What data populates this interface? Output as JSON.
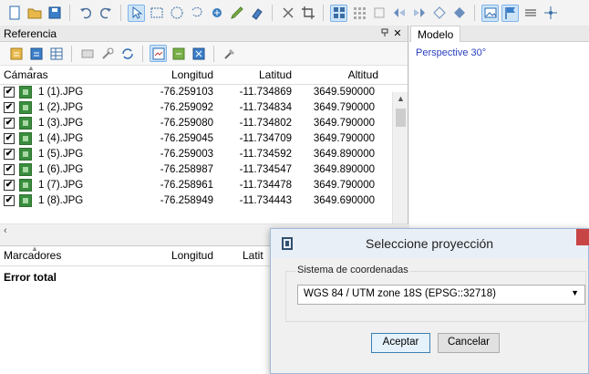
{
  "toolbar": {
    "icons": [
      "new-icon",
      "open-icon",
      "save-icon",
      "undo-icon",
      "redo-icon",
      "select-icon",
      "rect-select-icon",
      "circle-select-icon",
      "lasso-icon",
      "add-marker-icon",
      "draw-icon",
      "paint-icon",
      "delete-selection-icon",
      "crop-icon",
      "grid-icon",
      "dense-grid-icon",
      "transform-icon",
      "rotate-left-icon",
      "rotate-right-icon",
      "nav-icon",
      "rotate-icon",
      "image-icon",
      "flag-icon",
      "layers-icon",
      "move-icon"
    ]
  },
  "reference_pane": {
    "title": "Referencia",
    "pin": "ꝏ",
    "close": "✕",
    "columns": {
      "name": "Cámaras",
      "lon": "Longitud",
      "lat": "Latitud",
      "alt": "Altitud"
    },
    "cameras": [
      {
        "checked": true,
        "name": "1 (1).JPG",
        "lon": "-76.259103",
        "lat": "-11.734869",
        "alt": "3649.590000"
      },
      {
        "checked": true,
        "name": "1 (2).JPG",
        "lon": "-76.259092",
        "lat": "-11.734834",
        "alt": "3649.790000"
      },
      {
        "checked": true,
        "name": "1 (3).JPG",
        "lon": "-76.259080",
        "lat": "-11.734802",
        "alt": "3649.790000"
      },
      {
        "checked": true,
        "name": "1 (4).JPG",
        "lon": "-76.259045",
        "lat": "-11.734709",
        "alt": "3649.790000"
      },
      {
        "checked": true,
        "name": "1 (5).JPG",
        "lon": "-76.259003",
        "lat": "-11.734592",
        "alt": "3649.890000"
      },
      {
        "checked": true,
        "name": "1 (6).JPG",
        "lon": "-76.258987",
        "lat": "-11.734547",
        "alt": "3649.890000"
      },
      {
        "checked": true,
        "name": "1 (7).JPG",
        "lon": "-76.258961",
        "lat": "-11.734478",
        "alt": "3649.790000"
      },
      {
        "checked": true,
        "name": "1 (8).JPG",
        "lon": "-76.258949",
        "lat": "-11.734443",
        "alt": "3649.690000"
      }
    ],
    "marker_columns": {
      "name": "Marcadores",
      "lon": "Longitud",
      "lat": "Latit"
    },
    "error_label": "Error total"
  },
  "model_pane": {
    "tab": "Modelo",
    "view_label": "Perspective 30°"
  },
  "dialog": {
    "title": "Seleccione proyección",
    "group_label": "Sistema de coordenadas",
    "selected": "WGS 84 / UTM zone 18S (EPSG::32718)",
    "ok": "Aceptar",
    "cancel": "Cancelar"
  },
  "colors": {
    "accent": "#2a3fbf",
    "selection": "#cde4f7",
    "close": "#c74545"
  }
}
